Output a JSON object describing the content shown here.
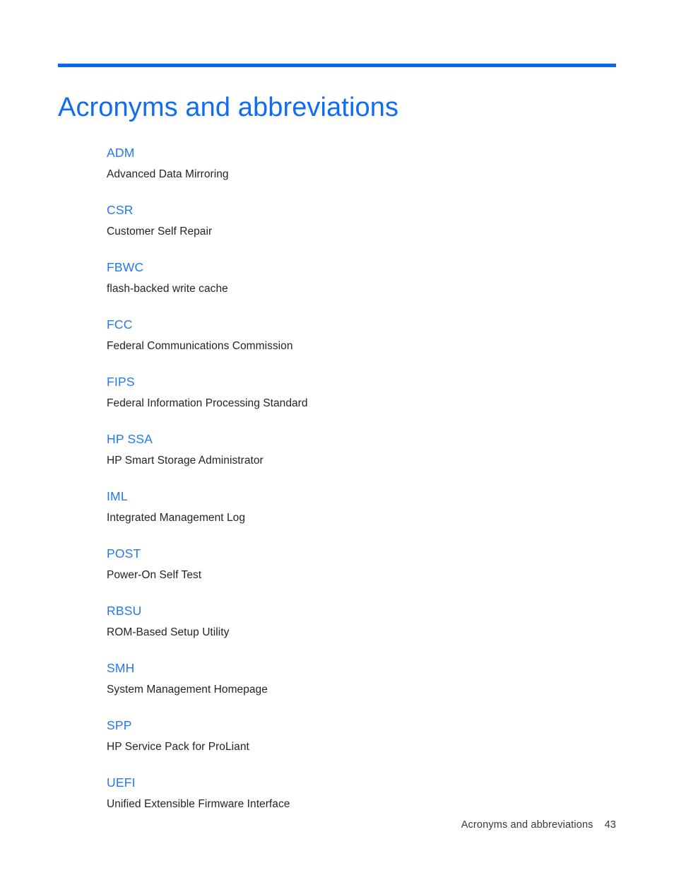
{
  "document": {
    "title": "Acronyms and abbreviations",
    "accent_color": "#0a66f0",
    "heading_color": "#0f6cf3",
    "term_color": "#2378f0",
    "body_color": "#26222a"
  },
  "glossary": {
    "entries": [
      {
        "term": "ADM",
        "definition": "Advanced Data Mirroring"
      },
      {
        "term": "CSR",
        "definition": "Customer Self Repair"
      },
      {
        "term": "FBWC",
        "definition": "flash-backed write cache"
      },
      {
        "term": "FCC",
        "definition": "Federal Communications Commission"
      },
      {
        "term": "FIPS",
        "definition": "Federal Information Processing Standard"
      },
      {
        "term": "HP SSA",
        "definition": "HP Smart Storage Administrator"
      },
      {
        "term": "IML",
        "definition": "Integrated Management Log"
      },
      {
        "term": "POST",
        "definition": "Power-On Self Test"
      },
      {
        "term": "RBSU",
        "definition": "ROM-Based Setup Utility"
      },
      {
        "term": "SMH",
        "definition": "System Management Homepage"
      },
      {
        "term": "SPP",
        "definition": "HP Service Pack for ProLiant"
      },
      {
        "term": "UEFI",
        "definition": "Unified Extensible Firmware Interface"
      }
    ]
  },
  "footer": {
    "section_label": "Acronyms and abbreviations",
    "page_number": "43"
  }
}
